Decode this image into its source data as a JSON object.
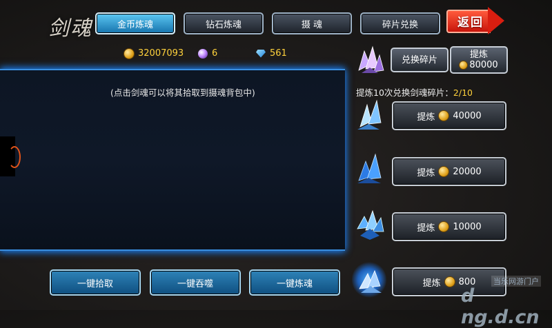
{
  "title": "剑魂",
  "tabs": [
    {
      "label": "金币炼魂",
      "active": true
    },
    {
      "label": "钻石炼魂",
      "active": false
    },
    {
      "label": "摄 魂",
      "active": false
    },
    {
      "label": "碎片兑换",
      "active": false
    }
  ],
  "back_label": "返回",
  "resources": {
    "gold": "32007093",
    "soul_orb": "6",
    "diamond": "561"
  },
  "hint": "(点击剑魂可以将其拾取到摄魂背包中)",
  "fragments": {
    "exchange_label": "兑换碎片",
    "refine_label": "提炼",
    "refine_cost": "80000"
  },
  "counter": {
    "label": "提炼10次兑换剑魂碎片：",
    "value": "2/10"
  },
  "refine_options": [
    {
      "label": "提炼",
      "cost": "40000"
    },
    {
      "label": "提炼",
      "cost": "20000"
    },
    {
      "label": "提炼",
      "cost": "10000"
    },
    {
      "label": "提炼",
      "cost": "800"
    }
  ],
  "bottom_buttons": [
    "一键拾取",
    "一键吞噬",
    "一键炼魂"
  ],
  "watermark": {
    "line1": "当乐网游门户",
    "line2": "d ng.d.cn"
  },
  "colors": {
    "accent": "#3a8fe0",
    "active_tab": "#1f8fd0",
    "back": "#d91e10",
    "counter_value": "#ffd23c"
  }
}
